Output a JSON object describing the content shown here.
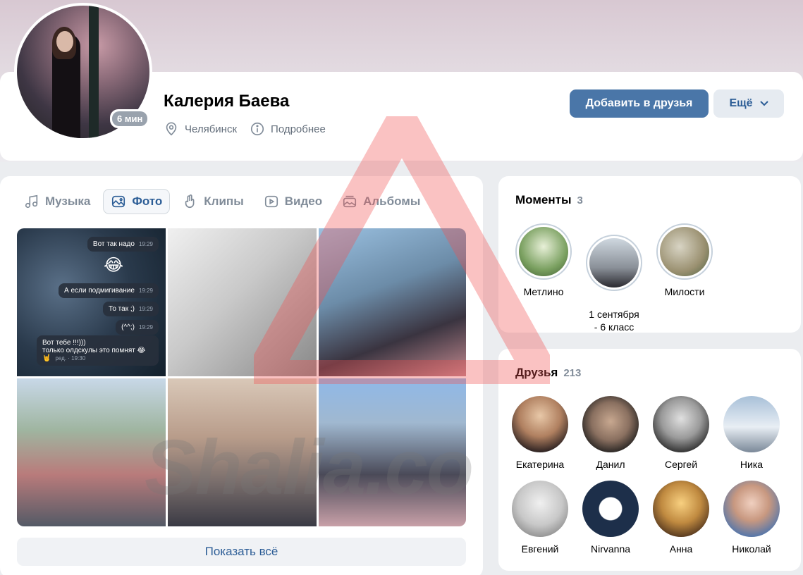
{
  "profile": {
    "name": "Калерия Баева",
    "online_badge": "6 мин",
    "city": "Челябинск",
    "details_label": "Подробнее",
    "add_friend_label": "Добавить в друзья",
    "more_label": "Ещё"
  },
  "media": {
    "tabs": [
      {
        "label": "Музыка",
        "icon": "music-icon",
        "active": false
      },
      {
        "label": "Фото",
        "icon": "photo-icon",
        "active": true
      },
      {
        "label": "Клипы",
        "icon": "clips-icon",
        "active": false
      },
      {
        "label": "Видео",
        "icon": "video-icon",
        "active": false
      },
      {
        "label": "Альбомы",
        "icon": "albums-icon",
        "active": false
      }
    ],
    "chat_messages": [
      {
        "text": "Вот так надо",
        "time": "19:29"
      },
      {
        "text": "😂",
        "time": "19:29"
      },
      {
        "text": "А если подмигивание",
        "time": "19:29"
      },
      {
        "text": "То так ;)",
        "time": "19:29"
      },
      {
        "text": "(^^;)",
        "time": "19:29"
      },
      {
        "text": "Вот тебе !!!)))\nтолько олдскулы это помнят 😂\n🤘",
        "time": "ред. · 19:30"
      }
    ],
    "show_all_label": "Показать всё"
  },
  "moments": {
    "title": "Моменты",
    "count": "3",
    "items": [
      {
        "label": "Метлино"
      },
      {
        "label": "1 сентября\n- 6 класс"
      },
      {
        "label": "Милости"
      }
    ]
  },
  "friends": {
    "title": "Друзья",
    "count": "213",
    "items": [
      {
        "label": "Екатерина"
      },
      {
        "label": "Данил"
      },
      {
        "label": "Сергей"
      },
      {
        "label": "Ника"
      },
      {
        "label": "Евгений"
      },
      {
        "label": "Nirvanna"
      },
      {
        "label": "Анна"
      },
      {
        "label": "Николай"
      }
    ]
  },
  "watermark": {
    "text": "Shalia.co"
  },
  "colors": {
    "accent": "#4a76a8",
    "link": "#2c5d96",
    "muted": "#818c99",
    "background": "#ebedf0"
  }
}
